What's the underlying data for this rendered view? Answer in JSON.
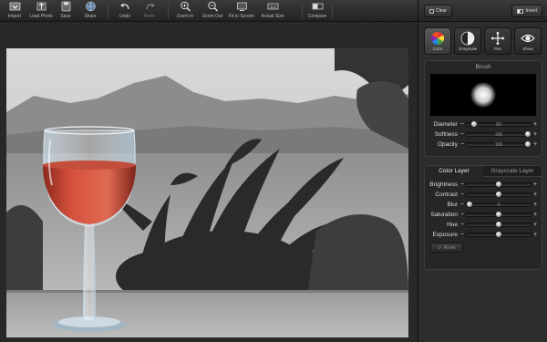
{
  "toolbar": {
    "buttons": [
      {
        "label": "Import",
        "icon": "import-icon",
        "enabled": true
      },
      {
        "label": "Load Photo",
        "icon": "load-photo-icon",
        "enabled": true
      },
      {
        "label": "Save",
        "icon": "save-icon",
        "enabled": true
      },
      {
        "label": "Share",
        "icon": "share-icon",
        "enabled": true
      },
      {
        "label": "Undo",
        "icon": "undo-icon",
        "enabled": true
      },
      {
        "label": "Redo",
        "icon": "redo-icon",
        "enabled": false
      },
      {
        "label": "Zoom In",
        "icon": "zoom-in-icon",
        "enabled": true
      },
      {
        "label": "Zoom Out",
        "icon": "zoom-out-icon",
        "enabled": true
      },
      {
        "label": "Fit to Screen",
        "icon": "fit-to-screen-icon",
        "enabled": true
      },
      {
        "label": "Actual Size",
        "icon": "actual-size-icon",
        "enabled": true
      },
      {
        "label": "Compare",
        "icon": "compare-icon",
        "enabled": true
      }
    ]
  },
  "panel": {
    "clear_label": "Clear",
    "invert_label": "Invert",
    "modes": [
      {
        "label": "Color",
        "icon": "color-wheel-icon",
        "active": true
      },
      {
        "label": "Grayscale",
        "icon": "grayscale-icon",
        "active": false
      },
      {
        "label": "Pan",
        "icon": "pan-arrows-icon",
        "active": false
      },
      {
        "label": "Show",
        "icon": "eye-icon",
        "active": false
      }
    ],
    "brush": {
      "title": "Brush",
      "sliders": [
        {
          "label": "Diameter",
          "value": "60",
          "fraction": 0.08
        },
        {
          "label": "Softness",
          "value": "100",
          "fraction": 1.0
        },
        {
          "label": "Opacity",
          "value": "100",
          "fraction": 1.0
        }
      ]
    },
    "layers": {
      "tabs": [
        {
          "label": "Color Layer",
          "active": true
        },
        {
          "label": "Grayscale Layer",
          "active": false
        }
      ],
      "sliders": [
        {
          "label": "Brightness",
          "value": "",
          "fraction": 0.5
        },
        {
          "label": "Contrast",
          "value": "",
          "fraction": 0.5
        },
        {
          "label": "Blur",
          "value": "0",
          "fraction": 0.0
        },
        {
          "label": "Saturation",
          "value": "",
          "fraction": 0.5
        },
        {
          "label": "Hue",
          "value": "",
          "fraction": 0.5
        },
        {
          "label": "Exposure",
          "value": "",
          "fraction": 0.5
        }
      ],
      "reset_label": "Reset"
    }
  },
  "colors": {
    "wine": "#c8473a",
    "panel_bg": "#2d2d2d",
    "toolbar_bg": "#2e2e2e"
  }
}
